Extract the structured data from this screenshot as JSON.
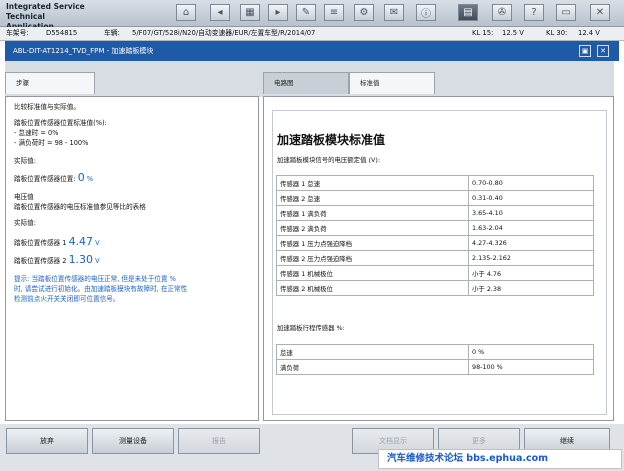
{
  "window": {
    "title_line1": "Integrated Service Technical",
    "title_line2": "Application"
  },
  "toolbar": [
    {
      "name": "home-icon",
      "glyph": "⌂"
    },
    {
      "name": "back-icon",
      "glyph": "◂"
    },
    {
      "name": "grid-icon",
      "glyph": "▦"
    },
    {
      "name": "forward-icon",
      "glyph": "▸"
    },
    {
      "name": "wrench-icon",
      "glyph": "✎"
    },
    {
      "name": "list-icon",
      "glyph": "≡"
    },
    {
      "name": "tools-icon",
      "glyph": "⚙"
    },
    {
      "name": "mail-icon",
      "glyph": "✉"
    },
    {
      "name": "info-icon",
      "glyph": "ⓘ"
    },
    {
      "name": "screen-icon",
      "glyph": "▤"
    },
    {
      "name": "settings-icon",
      "glyph": "✇"
    },
    {
      "name": "help-icon",
      "glyph": "?"
    },
    {
      "name": "minimize-icon",
      "glyph": "▭"
    },
    {
      "name": "close-icon",
      "glyph": "✕"
    }
  ],
  "infobar": {
    "vin_label": "车架号:",
    "vin_value": "D554815",
    "vehicle_label": "车辆:",
    "vehicle_value": "5/F07/GT/528i/N20/自动变速器/EUR/左置车型/R/2014/07",
    "kl15_label": "KL 15:",
    "kl15_value": "12.5 V",
    "kl30_label": "KL 30:",
    "kl30_value": "12.4 V"
  },
  "header": {
    "title": "ABL-DIT-AT1214_TVD_FPM - 加速踏板模块"
  },
  "tabs": {
    "steps": "步骤",
    "circuit": "电路图",
    "standard": "标准值"
  },
  "left": {
    "l1": "比较标准值与实际值。",
    "l2": "踏板位置传感器位置标准值(%):",
    "l3": "- 怠速时 = 0%",
    "l4": "- 满负荷时 = 98 - 100%",
    "l5": "实际值:",
    "l6": "踏板位置传感器位置:",
    "l6_value": "0",
    "l6_unit": "%",
    "l7": "电压值",
    "l8": "踏板位置传感器的电压标准值参见等比的表格",
    "l9": "实际值:",
    "s1_label": "踏板位置传感器 1",
    "s1_value": "4.47",
    "s1_unit": "V",
    "s2_label": "踏板位置传感器 2",
    "s2_value": "1.30",
    "s2_unit": "V",
    "hint1": "提示: 当踏板位置传感器的电压正常, 但是未处于位置 %",
    "hint2": "时, 请尝试进行初始化。由加速踏板模块有故障时, 在正常性",
    "hint3": "检测前点火开关关闭即可位置信号。"
  },
  "right": {
    "title": "加速踏板模块标准值",
    "subtitle": "加速踏板模块信号的电压额定值 (V):",
    "table1": [
      [
        "传感器 1 怠速",
        "0.70-0.80"
      ],
      [
        "传感器 2 怠速",
        "0.31-0.40"
      ],
      [
        "传感器 1 满负荷",
        "3.65-4.10"
      ],
      [
        "传感器 2 满负荷",
        "1.63-2.04"
      ],
      [
        "传感器 1 压力点强迫降档",
        "4.27-4.326"
      ],
      [
        "传感器 2 压力点强迫降档",
        "2.135-2.162"
      ],
      [
        "传感器 1 机械极位",
        "小于 4.76"
      ],
      [
        "传感器 2 机械极位",
        "小于 2.38"
      ]
    ],
    "subtitle2": "加速踏板行程传感器 %:",
    "table2": [
      [
        "怠速",
        "0 %"
      ],
      [
        "满负荷",
        "98-100 %"
      ]
    ]
  },
  "bottom": {
    "b1": "放弃",
    "b2": "测量设备",
    "b3": "报告",
    "b4": "文档显示",
    "b5": "更多",
    "b6": "继续"
  },
  "watermark": "汽车维修技术论坛 bbs.ephua.com"
}
